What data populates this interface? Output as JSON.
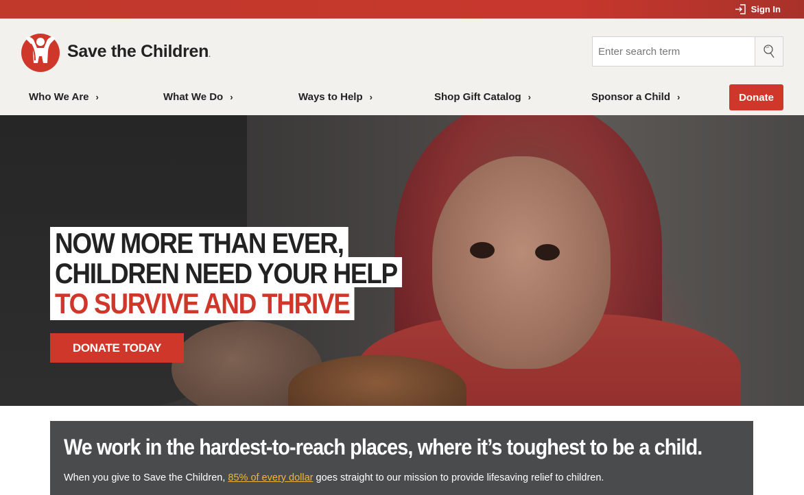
{
  "topbar": {
    "signin_label": "Sign In"
  },
  "header": {
    "logo_text": "Save the Children",
    "search": {
      "placeholder": "Enter search term"
    },
    "nav": [
      {
        "label": "Who We Are"
      },
      {
        "label": "What We Do"
      },
      {
        "label": "Ways to Help"
      },
      {
        "label": "Shop Gift Catalog"
      },
      {
        "label": "Sponsor a Child"
      }
    ],
    "donate_label": "Donate"
  },
  "hero": {
    "headline": [
      "NOW MORE THAN EVER,",
      "CHILDREN NEED YOUR HELP",
      "TO SURVIVE AND THRIVE"
    ],
    "cta_label": "DONATE TODAY"
  },
  "mission": {
    "title": "We work in the hardest-to-reach places, where it’s toughest to be a child.",
    "text_before": "When you give to Save the Children, ",
    "link": "85% of every dollar",
    "text_after": " goes straight to our mission to provide lifesaving relief to children."
  },
  "colors": {
    "brand_red": "#d0372b",
    "link_gold": "#f0b53b",
    "header_bg": "#f2f1ee",
    "mission_bg": "#4a4b4d"
  }
}
